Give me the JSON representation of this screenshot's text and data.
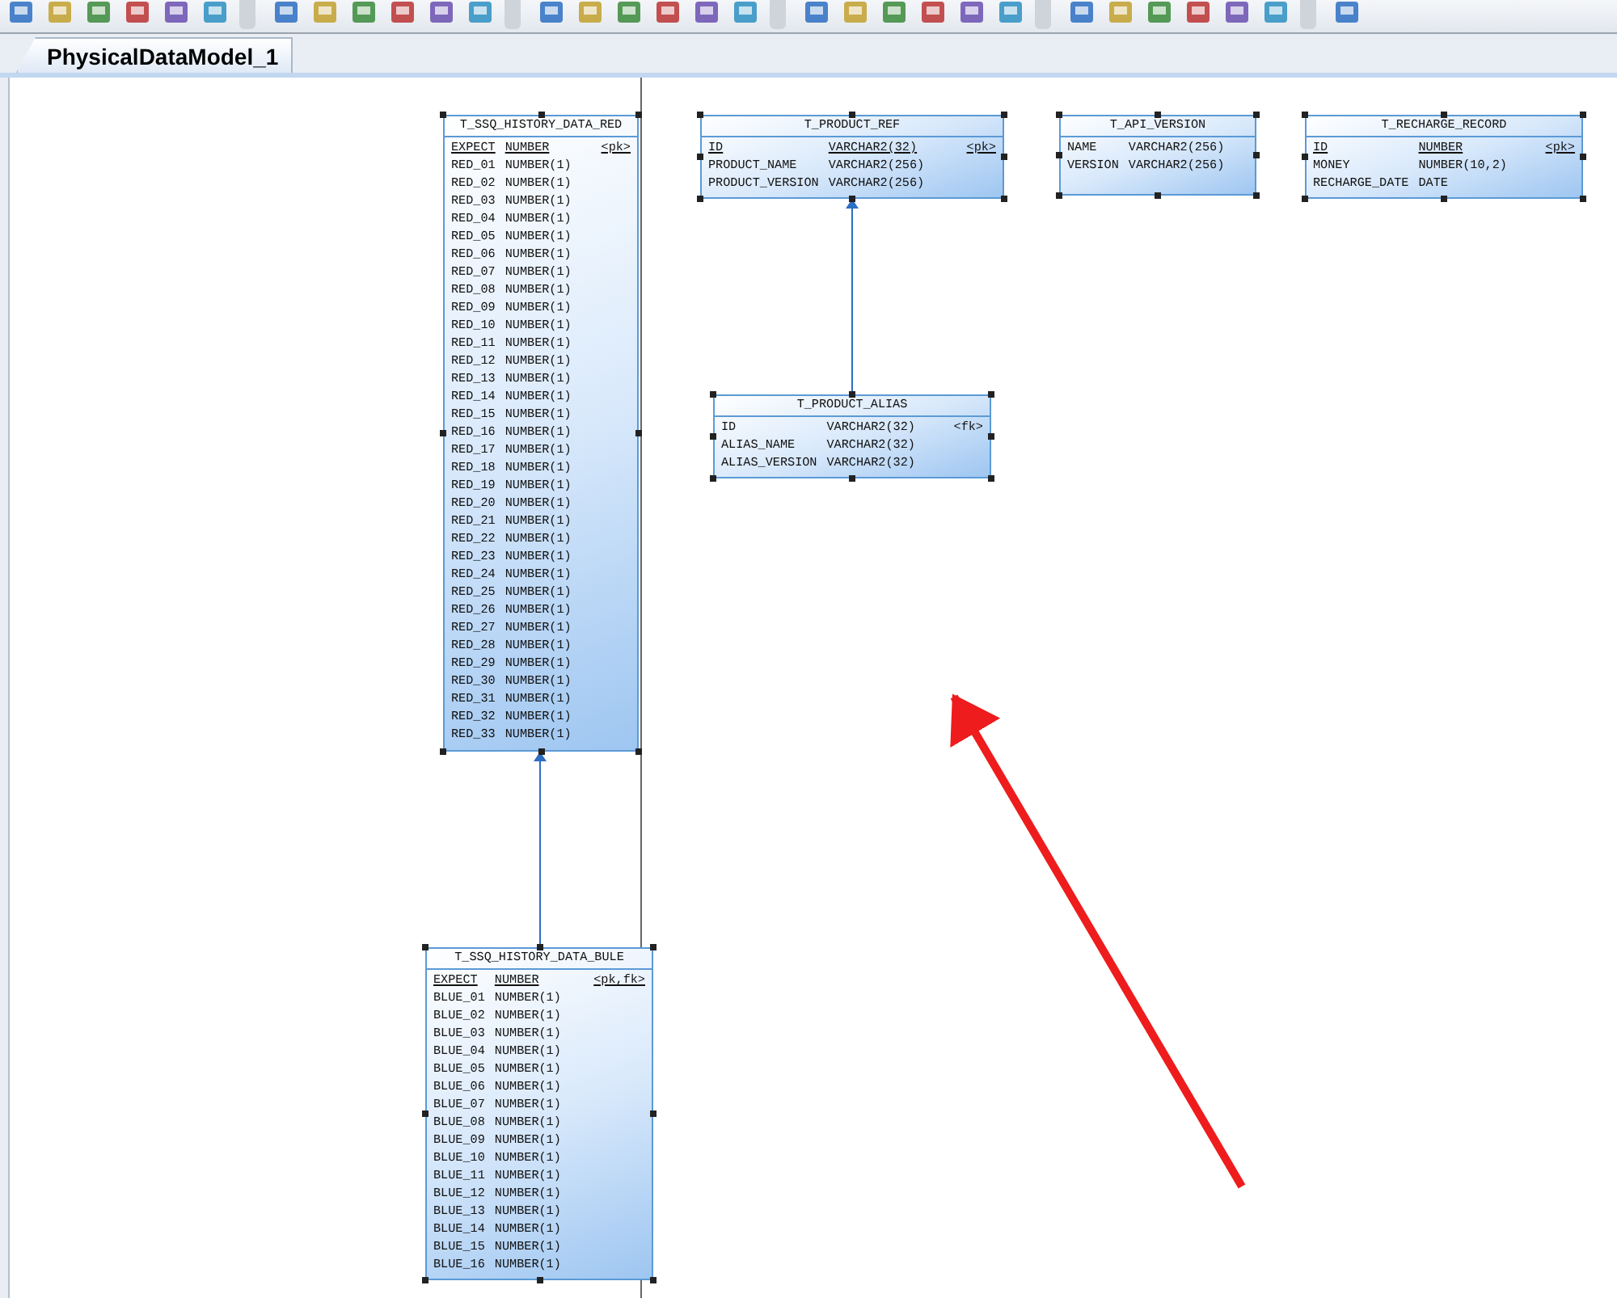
{
  "tab": {
    "label": "PhysicalDataModel_1",
    "selected": true
  },
  "tables": [
    {
      "name": "T_SSQ_HISTORY_DATA_RED",
      "selected": true,
      "columns": [
        {
          "name": "EXPECT",
          "type": "NUMBER",
          "key": "<pk>",
          "pk": true
        },
        {
          "name": "RED_01",
          "type": "NUMBER(1)",
          "pk": false
        },
        {
          "name": "RED_02",
          "type": "NUMBER(1)",
          "pk": false
        },
        {
          "name": "RED_03",
          "type": "NUMBER(1)",
          "pk": false
        },
        {
          "name": "RED_04",
          "type": "NUMBER(1)",
          "pk": false
        },
        {
          "name": "RED_05",
          "type": "NUMBER(1)",
          "pk": false
        },
        {
          "name": "RED_06",
          "type": "NUMBER(1)",
          "pk": false
        },
        {
          "name": "RED_07",
          "type": "NUMBER(1)",
          "pk": false
        },
        {
          "name": "RED_08",
          "type": "NUMBER(1)",
          "pk": false
        },
        {
          "name": "RED_09",
          "type": "NUMBER(1)",
          "pk": false
        },
        {
          "name": "RED_10",
          "type": "NUMBER(1)",
          "pk": false
        },
        {
          "name": "RED_11",
          "type": "NUMBER(1)",
          "pk": false
        },
        {
          "name": "RED_12",
          "type": "NUMBER(1)",
          "pk": false
        },
        {
          "name": "RED_13",
          "type": "NUMBER(1)",
          "pk": false
        },
        {
          "name": "RED_14",
          "type": "NUMBER(1)",
          "pk": false
        },
        {
          "name": "RED_15",
          "type": "NUMBER(1)",
          "pk": false
        },
        {
          "name": "RED_16",
          "type": "NUMBER(1)",
          "pk": false
        },
        {
          "name": "RED_17",
          "type": "NUMBER(1)",
          "pk": false
        },
        {
          "name": "RED_18",
          "type": "NUMBER(1)",
          "pk": false
        },
        {
          "name": "RED_19",
          "type": "NUMBER(1)",
          "pk": false
        },
        {
          "name": "RED_20",
          "type": "NUMBER(1)",
          "pk": false
        },
        {
          "name": "RED_21",
          "type": "NUMBER(1)",
          "pk": false
        },
        {
          "name": "RED_22",
          "type": "NUMBER(1)",
          "pk": false
        },
        {
          "name": "RED_23",
          "type": "NUMBER(1)",
          "pk": false
        },
        {
          "name": "RED_24",
          "type": "NUMBER(1)",
          "pk": false
        },
        {
          "name": "RED_25",
          "type": "NUMBER(1)",
          "pk": false
        },
        {
          "name": "RED_26",
          "type": "NUMBER(1)",
          "pk": false
        },
        {
          "name": "RED_27",
          "type": "NUMBER(1)",
          "pk": false
        },
        {
          "name": "RED_28",
          "type": "NUMBER(1)",
          "pk": false
        },
        {
          "name": "RED_29",
          "type": "NUMBER(1)",
          "pk": false
        },
        {
          "name": "RED_30",
          "type": "NUMBER(1)",
          "pk": false
        },
        {
          "name": "RED_31",
          "type": "NUMBER(1)",
          "pk": false
        },
        {
          "name": "RED_32",
          "type": "NUMBER(1)",
          "pk": false
        },
        {
          "name": "RED_33",
          "type": "NUMBER(1)",
          "pk": false
        }
      ]
    },
    {
      "name": "T_PRODUCT_REF",
      "selected": true,
      "columns": [
        {
          "name": "ID",
          "type": "VARCHAR2(32)",
          "key": "<pk>",
          "pk": true
        },
        {
          "name": "PRODUCT_NAME",
          "type": "VARCHAR2(256)",
          "pk": false
        },
        {
          "name": "PRODUCT_VERSION",
          "type": "VARCHAR2(256)",
          "pk": false
        }
      ]
    },
    {
      "name": "T_API_VERSION",
      "selected": true,
      "columns": [
        {
          "name": "NAME",
          "type": "VARCHAR2(256)",
          "pk": false
        },
        {
          "name": "VERSION",
          "type": "VARCHAR2(256)",
          "pk": false
        }
      ]
    },
    {
      "name": "T_RECHARGE_RECORD",
      "selected": true,
      "columns": [
        {
          "name": "ID",
          "type": "NUMBER",
          "key": "<pk>",
          "pk": true
        },
        {
          "name": "MONEY",
          "type": "NUMBER(10,2)",
          "pk": false
        },
        {
          "name": "RECHARGE_DATE",
          "type": "DATE",
          "pk": false
        }
      ]
    },
    {
      "name": "T_PRODUCT_ALIAS",
      "selected": true,
      "columns": [
        {
          "name": "ID",
          "type": "VARCHAR2(32)",
          "key": "<fk>",
          "pk": false
        },
        {
          "name": "ALIAS_NAME",
          "type": "VARCHAR2(32)",
          "pk": false
        },
        {
          "name": "ALIAS_VERSION",
          "type": "VARCHAR2(32)",
          "pk": false
        }
      ]
    },
    {
      "name": "T_SSQ_HISTORY_DATA_BULE",
      "selected": true,
      "columns": [
        {
          "name": "EXPECT",
          "type": "NUMBER",
          "key": "<pk,fk>",
          "pk": true
        },
        {
          "name": "BLUE_01",
          "type": "NUMBER(1)",
          "pk": false
        },
        {
          "name": "BLUE_02",
          "type": "NUMBER(1)",
          "pk": false
        },
        {
          "name": "BLUE_03",
          "type": "NUMBER(1)",
          "pk": false
        },
        {
          "name": "BLUE_04",
          "type": "NUMBER(1)",
          "pk": false
        },
        {
          "name": "BLUE_05",
          "type": "NUMBER(1)",
          "pk": false
        },
        {
          "name": "BLUE_06",
          "type": "NUMBER(1)",
          "pk": false
        },
        {
          "name": "BLUE_07",
          "type": "NUMBER(1)",
          "pk": false
        },
        {
          "name": "BLUE_08",
          "type": "NUMBER(1)",
          "pk": false
        },
        {
          "name": "BLUE_09",
          "type": "NUMBER(1)",
          "pk": false
        },
        {
          "name": "BLUE_10",
          "type": "NUMBER(1)",
          "pk": false
        },
        {
          "name": "BLUE_11",
          "type": "NUMBER(1)",
          "pk": false
        },
        {
          "name": "BLUE_12",
          "type": "NUMBER(1)",
          "pk": false
        },
        {
          "name": "BLUE_13",
          "type": "NUMBER(1)",
          "pk": false
        },
        {
          "name": "BLUE_14",
          "type": "NUMBER(1)",
          "pk": false
        },
        {
          "name": "BLUE_15",
          "type": "NUMBER(1)",
          "pk": false
        },
        {
          "name": "BLUE_16",
          "type": "NUMBER(1)",
          "pk": false
        }
      ]
    }
  ]
}
